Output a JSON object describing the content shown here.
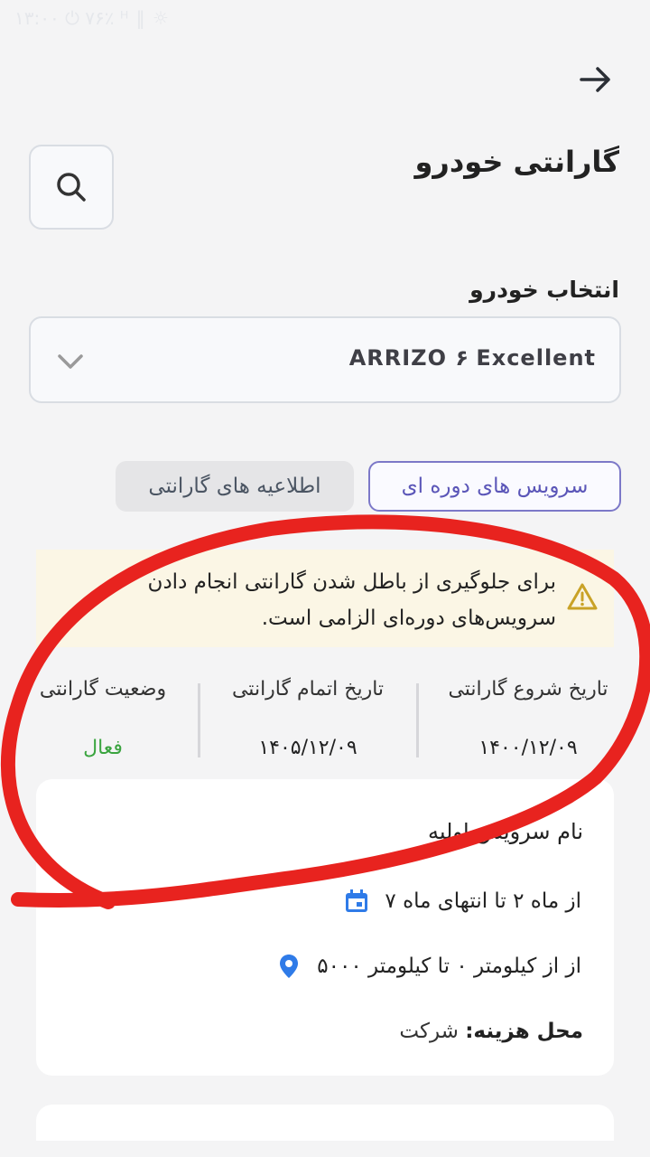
{
  "status_bar": {
    "text": "۱۳:۰۰ ⏻ ۷۶٪ ᴴ ‖ ☼"
  },
  "header": {
    "title": "گارانتی خودرو"
  },
  "vehicle_select": {
    "label": "انتخاب خودرو",
    "value": "ARRIZO ۶ Excellent"
  },
  "tabs": [
    {
      "label": "سرویس های دوره ای",
      "active": true
    },
    {
      "label": "اطلاعیه های گارانتی",
      "active": false
    }
  ],
  "notice": {
    "text_line1": "برای جلوگیری از باطل شدن گارانتی انجام دادن",
    "text_line2": "سرویس‌های دوره‌ای الزامی است."
  },
  "warranty_info": {
    "start": {
      "label": "تاریخ شروع گارانتی",
      "value": "۱۴۰۰/۱۲/۰۹"
    },
    "end": {
      "label": "تاریخ اتمام گارانتی",
      "value": "۱۴۰۵/۱۲/۰۹"
    },
    "status": {
      "label": "وضعیت گارانتی",
      "value": "فعال"
    }
  },
  "service_card": {
    "title": "نام سرویس اولیه",
    "period": "از ماه ۲ تا انتهای ماه ۷",
    "distance": "از از کیلومتر ۰ تا کیلومتر ۵۰۰۰",
    "cost_label": "محل هزینه:",
    "cost_value": "شرکت"
  },
  "colors": {
    "accent": "#5b56b8",
    "status_active": "#3aa43f",
    "icon_blue": "#2f7be8",
    "notice_bg": "#fbf6e5",
    "annotation_red": "#e8231f"
  }
}
